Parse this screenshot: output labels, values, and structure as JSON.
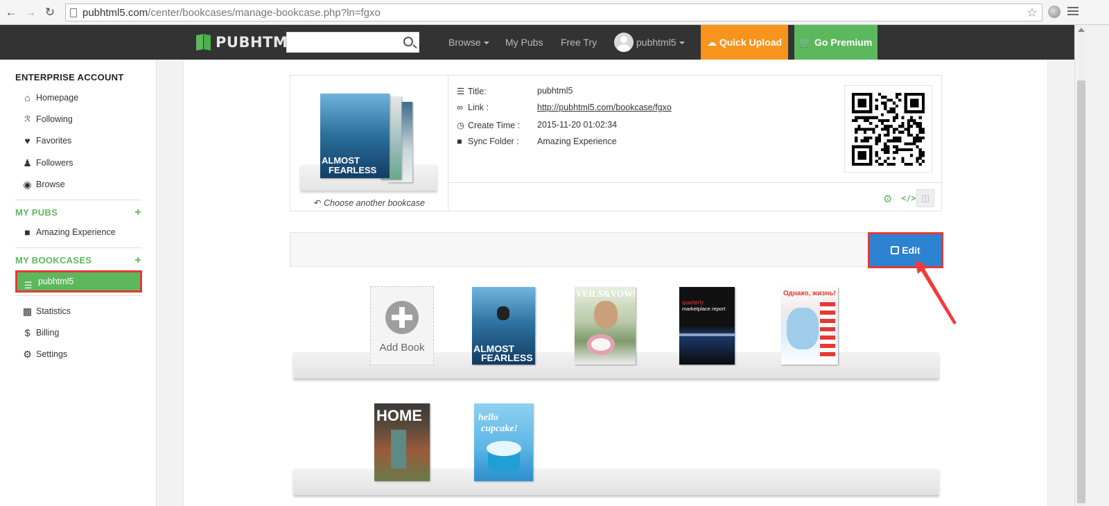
{
  "browser": {
    "url_host": "pubhtml5.com",
    "url_path": "/center/bookcases/manage-bookcase.php?ln=fgxo"
  },
  "nav": {
    "logo": "PUBHTML5",
    "search_placeholder": "",
    "browse": "Browse",
    "my_pubs": "My Pubs",
    "free_try": "Free Try",
    "username": "pubhtml5",
    "quick_upload": "Quick Upload",
    "go_premium": "Go Premium"
  },
  "sidebar": {
    "account_heading": "ENTERPRISE ACCOUNT",
    "main_items": [
      {
        "label": "Homepage",
        "icon": "home-icon"
      },
      {
        "label": "Following",
        "icon": "rss-icon"
      },
      {
        "label": "Favorites",
        "icon": "heart-icon"
      },
      {
        "label": "Followers",
        "icon": "users-icon"
      },
      {
        "label": "Browse",
        "icon": "eye-icon"
      }
    ],
    "my_pubs_heading": "MY PUBS",
    "pubs": [
      {
        "label": "Amazing Experience",
        "icon": "folder-icon"
      }
    ],
    "my_bookcases_heading": "MY BOOKCASES",
    "bookcases": [
      {
        "label": "pubhtml5",
        "icon": "library-icon"
      }
    ],
    "bottom_items": [
      {
        "label": "Statistics",
        "icon": "bar-chart-icon"
      },
      {
        "label": "Billing",
        "icon": "dollar-icon"
      },
      {
        "label": "Settings",
        "icon": "gear-icon"
      }
    ]
  },
  "bookcase": {
    "choose_label": "Choose another bookcase",
    "title_label": "Title:",
    "title_value": "pubhtml5",
    "link_label": "Link :",
    "link_value": "http://pubhtml5.com/bookcase/fgxo",
    "create_label": "Create Time :",
    "create_value": "2015-11-20 01:02:34",
    "sync_label": "Sync Folder :",
    "sync_value": "Amazing Experience"
  },
  "toolbar": {
    "edit_label": "Edit"
  },
  "books": {
    "add_label": "Add Book",
    "covers": [
      {
        "title_lines": [
          "ALMOST",
          "FEARLESS"
        ]
      },
      {
        "title_lines": [
          "VEILS&VOWS"
        ]
      },
      {
        "title_lines": [
          "quarterly",
          "marketplace report"
        ]
      },
      {
        "title_lines": [
          "Однако, жизнь!"
        ]
      },
      {
        "title_lines": [
          "HOME"
        ]
      },
      {
        "title_lines": [
          "hello",
          "cupcake!"
        ]
      }
    ]
  }
}
